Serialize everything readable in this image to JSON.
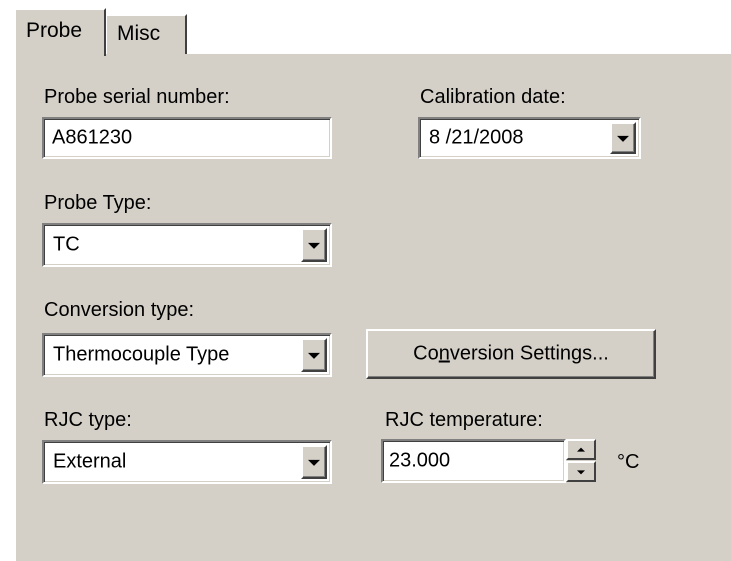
{
  "tabs": [
    {
      "label": "Probe",
      "selected": true
    },
    {
      "label": "Misc",
      "selected": false
    }
  ],
  "probe_serial": {
    "label": "Probe serial number:",
    "value": "A861230"
  },
  "calibration_date": {
    "label": "Calibration date:",
    "value": "8 /21/2008"
  },
  "probe_type": {
    "label": "Probe Type:",
    "value": "TC"
  },
  "conversion_type": {
    "label": "Conversion type:",
    "value": "Thermocouple Type"
  },
  "conversion_settings": {
    "label_pre": "Co",
    "label_underlined": "n",
    "label_post": "version Settings..."
  },
  "rjc_type": {
    "label": "RJC type:",
    "value": "External"
  },
  "rjc_temperature": {
    "label": "RJC temperature:",
    "value": "23.000",
    "unit": "°C"
  },
  "colors": {
    "dialog_face": "#d4d0c8",
    "highlight": "#ffffff",
    "shadow": "#808080",
    "dark_shadow": "#404040"
  }
}
